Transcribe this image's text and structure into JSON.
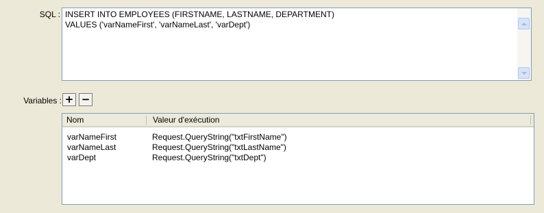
{
  "sql": {
    "label": "SQL :",
    "text": "INSERT INTO EMPLOYEES (FIRSTNAME, LASTNAME, DEPARTMENT)\nVALUES ('varNameFirst', 'varNameLast', 'varDept')"
  },
  "variables": {
    "label": "Variables :",
    "add_label": "+",
    "remove_label": "−",
    "columns": [
      "Nom",
      "Valeur d'exécution"
    ],
    "rows": [
      {
        "name": "varNameFirst",
        "value": "Request.QueryString(\"txtFirstName\")"
      },
      {
        "name": "varNameLast",
        "value": "Request.QueryString(\"txtLastName\")"
      },
      {
        "name": "varDept",
        "value": "Request.QueryString(\"txtDept\")"
      }
    ]
  }
}
